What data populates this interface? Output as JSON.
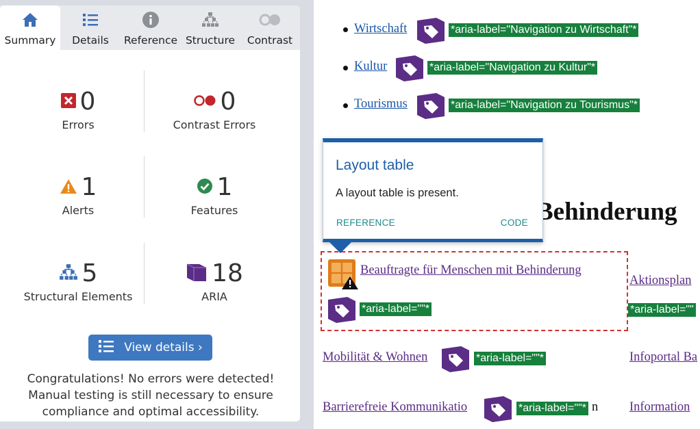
{
  "sidebar": {
    "tabs": [
      {
        "label": "Summary",
        "icon": "home-icon",
        "active": true
      },
      {
        "label": "Details",
        "icon": "list-icon"
      },
      {
        "label": "Reference",
        "icon": "info-icon"
      },
      {
        "label": "Structure",
        "icon": "hierarchy-icon"
      },
      {
        "label": "Contrast",
        "icon": "contrast-icon"
      }
    ],
    "stats": {
      "errors": {
        "count": "0",
        "label": "Errors",
        "icon": "error-icon"
      },
      "contrast_errors": {
        "count": "0",
        "label": "Contrast Errors",
        "icon": "contrast-error-icon"
      },
      "alerts": {
        "count": "1",
        "label": "Alerts",
        "icon": "alert-icon"
      },
      "features": {
        "count": "1",
        "label": "Features",
        "icon": "feature-icon"
      },
      "structural": {
        "count": "5",
        "label": "Structural Elements",
        "icon": "structure-icon"
      },
      "aria": {
        "count": "18",
        "label": "ARIA",
        "icon": "aria-icon"
      }
    },
    "view_details_label": "View details ›",
    "congrats": "Congratulations! No errors were detected! Manual testing is still necessary to ensure compliance and optimal accessibility."
  },
  "page": {
    "nav_items": [
      {
        "label": "Wirtschaft",
        "aria": "*aria-label=\"Navigation zu Wirtschaft\"*"
      },
      {
        "label": "Kultur",
        "aria": "*aria-label=\"Navigation zu Kultur\"*"
      },
      {
        "label": "Tourismus",
        "aria": "*aria-label=\"Navigation zu Tourismus\"*"
      }
    ],
    "heading_fragment": "Behinderung",
    "tooltip": {
      "title": "Layout table",
      "body": "A layout table is present.",
      "reference": "REFERENCE",
      "code": "CODE"
    },
    "layout_table": {
      "link": "Beauftragte für Menschen mit Behinderung",
      "aria": "*aria-label=\"\"*"
    },
    "right_col": {
      "link1": "Aktionsplan",
      "aria": "*aria-label=\"\"",
      "link2": "Infoportal Ba",
      "link3": "Information"
    },
    "row_mobility": {
      "link": "Mobilität & Wohnen",
      "aria": "*aria-label=\"\"*"
    },
    "row_barrier": {
      "link": "Barrierefreie Kommunikatio",
      "aria": "*aria-label=\"\"*",
      "suffix": "n"
    },
    "colors": {
      "aria_green": "#16803c",
      "tag_purple": "#5b2d86",
      "wave_blue": "#1f5ea8",
      "error_red": "#d32f2f"
    }
  }
}
